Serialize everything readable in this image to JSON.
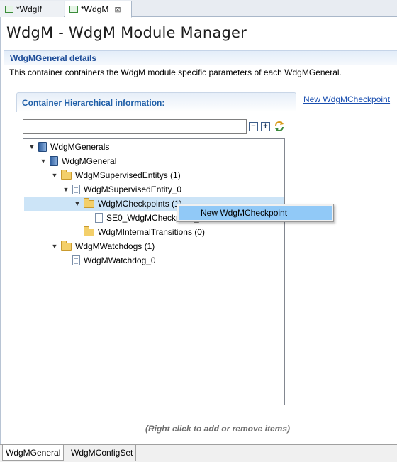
{
  "editor_tabs": [
    {
      "label": "*WdgIf",
      "active": false
    },
    {
      "label": "*WdgM",
      "active": true,
      "close_glyph": "⊠"
    }
  ],
  "page_title": "WdgM - WdgM Module Manager",
  "section": {
    "title": "WdgMGeneral details",
    "description": "This container containers the WdgM module specific parameters of each WdgMGeneral."
  },
  "group": {
    "title": "Container Hierarchical information:",
    "link": "New WdgMCheckpoint"
  },
  "filter": {
    "value": ""
  },
  "toolbar": {
    "collapse_glyph": "−",
    "expand_glyph": "+"
  },
  "tree": {
    "items": [
      {
        "label": "WdgMGenerals",
        "icon": "module-icon",
        "expanded": true
      },
      {
        "label": "WdgMGeneral",
        "icon": "module-icon",
        "expanded": true
      },
      {
        "label": "WdgMSupervisedEntitys (1)",
        "icon": "folder-icon",
        "expanded": true
      },
      {
        "label": "WdgMSupervisedEntity_0",
        "icon": "document-icon",
        "expanded": true
      },
      {
        "label": "WdgMCheckpoints (1)",
        "icon": "folder-icon",
        "expanded": true,
        "selected": true
      },
      {
        "label": "SE0_WdgMCheckpoint_0",
        "icon": "document-icon"
      },
      {
        "label": "WdgMInternalTransitions (0)",
        "icon": "folder-icon"
      },
      {
        "label": "WdgMWatchdogs (1)",
        "icon": "folder-icon",
        "expanded": true
      },
      {
        "label": "WdgMWatchdog_0",
        "icon": "document-icon"
      }
    ]
  },
  "context_menu": {
    "items": [
      {
        "label": "New WdgMCheckpoint",
        "highlighted": true
      }
    ]
  },
  "hint": "(Right click to add or remove items)",
  "bottom_tabs": [
    {
      "label": "WdgMGeneral",
      "active": true
    },
    {
      "label": "WdgMConfigSet",
      "active": false
    }
  ],
  "colors": {
    "accent": "#1f5fa8",
    "selection": "#cce4f7",
    "menu_highlight": "#91c9f7"
  }
}
